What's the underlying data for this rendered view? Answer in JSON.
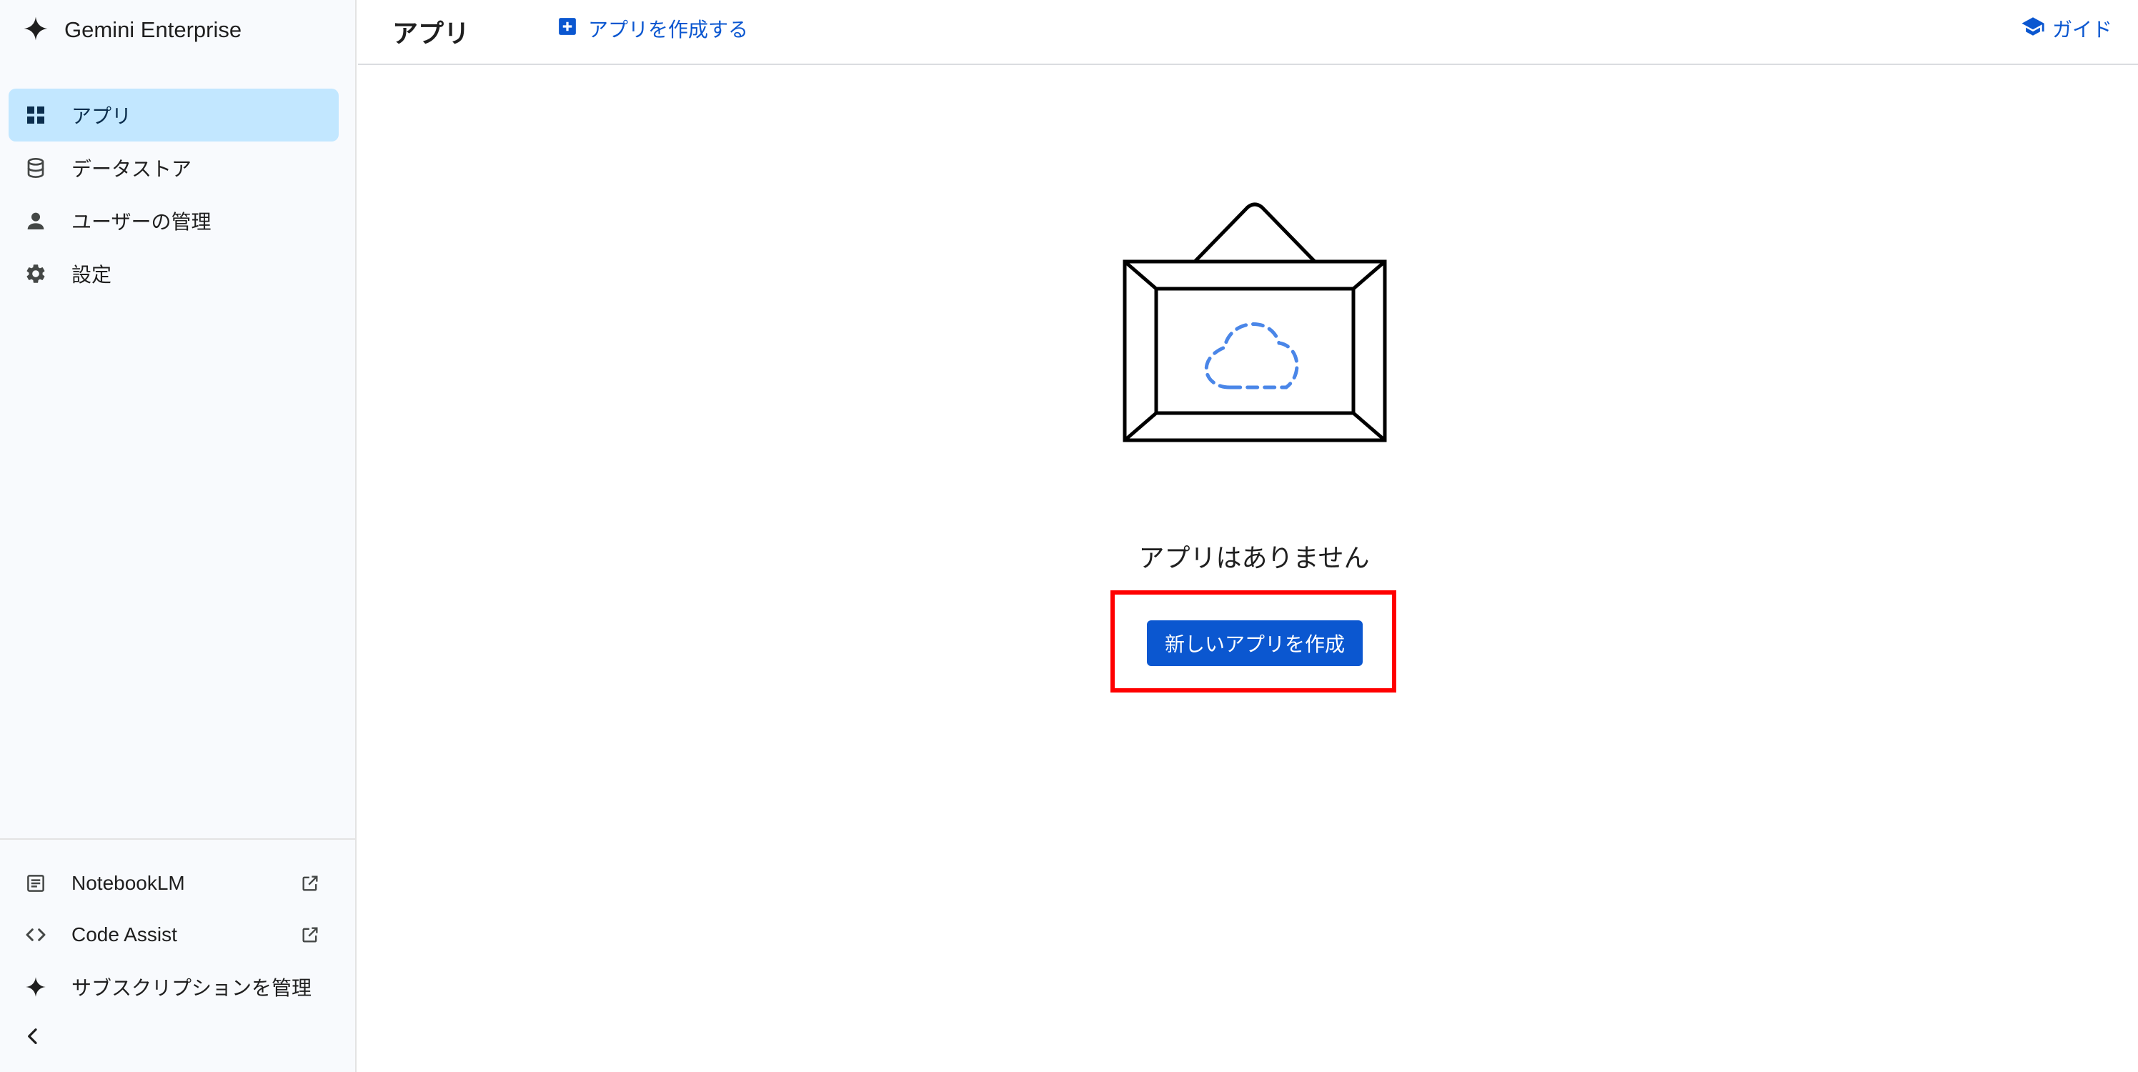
{
  "sidebar": {
    "brand": {
      "name": "Gemini Enterprise",
      "icon": "gemini-sparkle-icon"
    },
    "items": [
      {
        "label": "アプリ",
        "icon": "apps-grid-icon",
        "active": true
      },
      {
        "label": "データストア",
        "icon": "database-icon",
        "active": false
      },
      {
        "label": "ユーザーの管理",
        "icon": "person-icon",
        "active": false
      },
      {
        "label": "設定",
        "icon": "gear-icon",
        "active": false
      }
    ],
    "bottom_items": [
      {
        "label": "NotebookLM",
        "icon": "notebook-icon",
        "external": true
      },
      {
        "label": "Code Assist",
        "icon": "code-icon",
        "external": true
      },
      {
        "label": "サブスクリプションを管理",
        "icon": "sparkle-icon",
        "external": false
      }
    ],
    "collapse_icon": "chevron-left-icon"
  },
  "header": {
    "title": "アプリ",
    "create_link": "アプリを作成する",
    "guide_link": "ガイド"
  },
  "main": {
    "empty_message": "アプリはありません",
    "create_button": "新しいアプリを作成"
  },
  "colors": {
    "accent": "#0b57d0",
    "active_nav_bg": "#c2e7ff",
    "sidebar_bg": "#f8fafd",
    "highlight": "#ff0000",
    "cloud_dashed": "#4a86e8"
  }
}
